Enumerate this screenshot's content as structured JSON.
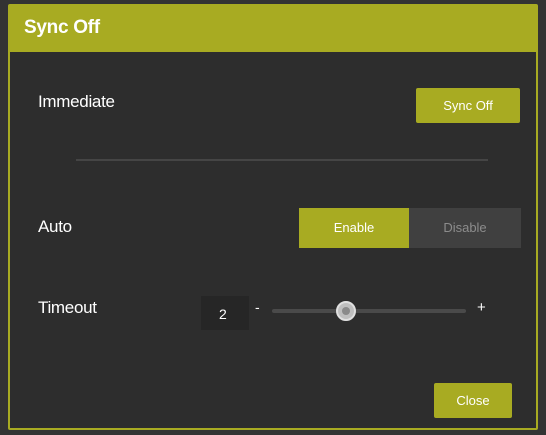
{
  "dialog": {
    "title": "Sync Off",
    "accent_color": "#a8ab22"
  },
  "immediate": {
    "label": "Immediate",
    "button_label": "Sync Off"
  },
  "auto": {
    "label": "Auto",
    "enable_label": "Enable",
    "disable_label": "Disable",
    "selected": "Enable"
  },
  "timeout": {
    "label": "Timeout",
    "value": "2",
    "minus_label": "-",
    "plus_label": "+",
    "slider_fraction": 0.38
  },
  "footer": {
    "close_label": "Close"
  }
}
